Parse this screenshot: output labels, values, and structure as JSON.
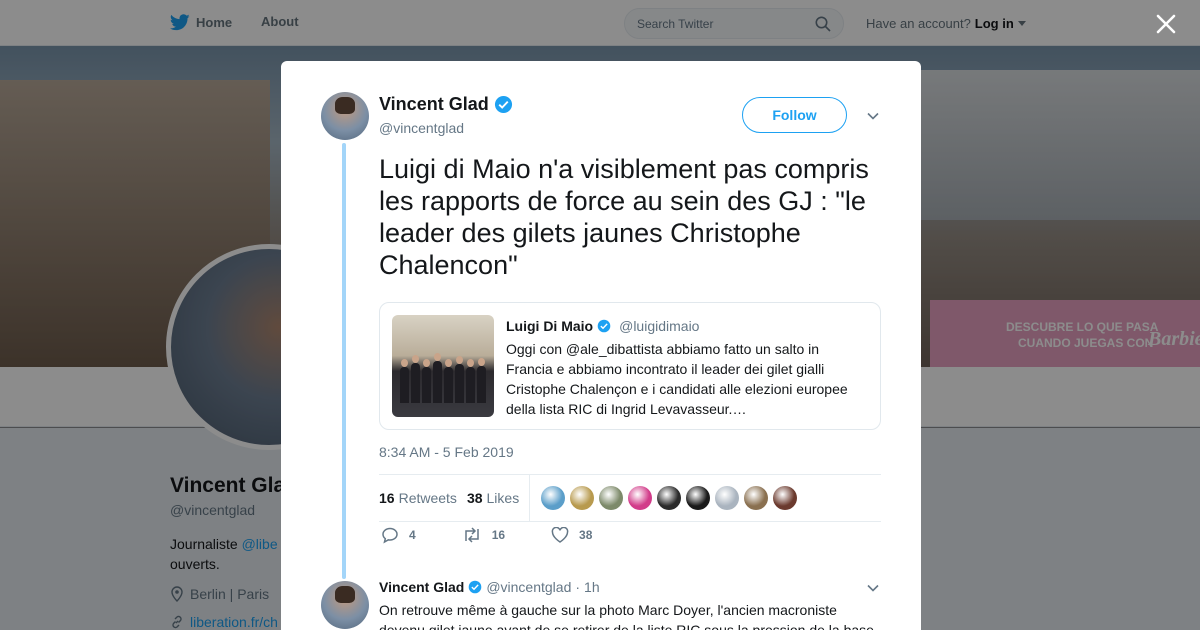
{
  "nav": {
    "home_label": "Home",
    "about_label": "About",
    "search_placeholder": "Search Twitter",
    "account_prompt": "Have an account?",
    "login_label": "Log in"
  },
  "banner": {
    "sign_text_1": "DESCUBRE LO QUE PASA",
    "sign_text_2": "CUANDO JUEGAS CON",
    "sign_brand": "Barbie"
  },
  "profile": {
    "name": "Vincent Glad",
    "handle": "@vincentglad",
    "bio_prefix": "Journaliste",
    "bio_link": "@libe",
    "bio_suffix": "ouverts.",
    "location": "Berlin | Paris",
    "url": "liberation.fr/ch"
  },
  "tweet": {
    "author_name": "Vincent Glad",
    "author_handle": "@vincentglad",
    "follow_label": "Follow",
    "text": "Luigi di Maio n'a visiblement pas compris les rapports de force au sein des GJ : \"le leader des gilets jaunes Christophe Chalencon\"",
    "timestamp": "8:34 AM - 5 Feb 2019",
    "retweets_count": "16",
    "retweets_label": "Retweets",
    "likes_count": "38",
    "likes_label": "Likes",
    "replies_action": "4",
    "retweets_action": "16",
    "likes_action": "38"
  },
  "quote": {
    "author_name": "Luigi Di Maio",
    "author_handle": "@luigidimaio",
    "text": "Oggi con @ale_dibattista abbiamo fatto un salto in Francia e abbiamo incontrato il leader dei gilet gialli Cristophe Chalençon e i candidati alle elezioni europee della lista RIC di Ingrid Levavasseur.…"
  },
  "reply": {
    "author_name": "Vincent Glad",
    "author_handle": "@vincentglad",
    "separator": "·",
    "age": "1h",
    "text": "On retrouve même à gauche sur la photo Marc Doyer, l'ancien macroniste devenu gilet jaune avant de se retirer de la liste RIC sous la pression de la base"
  },
  "likers": [
    "#5b9ec9",
    "#b89a4e",
    "#7d8a6a",
    "#d23c8a",
    "#2b2b2b",
    "#1a1a1a",
    "#aab4bf",
    "#8a7050",
    "#6b3a2e"
  ],
  "colors": {
    "brand": "#1da1f2",
    "verified": "#1da1f2",
    "text": "#14171a",
    "muted": "#657786"
  }
}
